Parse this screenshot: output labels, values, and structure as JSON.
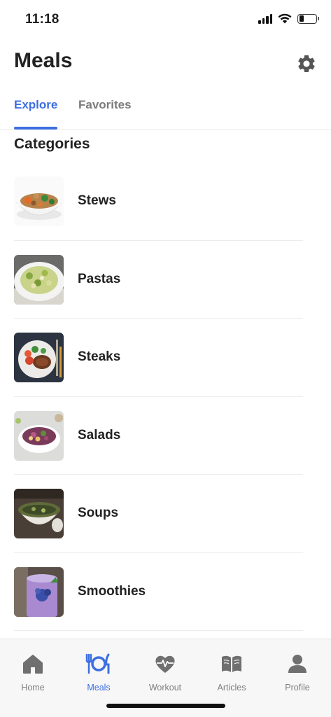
{
  "status_bar": {
    "time": "11:18"
  },
  "header": {
    "title": "Meals",
    "settings_icon": "gear-icon"
  },
  "tabs": [
    {
      "label": "Explore",
      "active": true
    },
    {
      "label": "Favorites",
      "active": false
    }
  ],
  "section": {
    "title": "Categories"
  },
  "categories": [
    {
      "label": "Stews",
      "image": "stew-bowl-image"
    },
    {
      "label": "Pastas",
      "image": "pasta-plate-image"
    },
    {
      "label": "Steaks",
      "image": "steak-plate-image"
    },
    {
      "label": "Salads",
      "image": "salad-bowl-image"
    },
    {
      "label": "Soups",
      "image": "soup-bowl-image"
    },
    {
      "label": "Smoothies",
      "image": "smoothie-glass-image"
    }
  ],
  "tab_bar": {
    "items": [
      {
        "label": "Home",
        "icon": "home-icon",
        "active": false
      },
      {
        "label": "Meals",
        "icon": "meals-icon",
        "active": true
      },
      {
        "label": "Workout",
        "icon": "heart-pulse-icon",
        "active": false
      },
      {
        "label": "Articles",
        "icon": "book-icon",
        "active": false
      },
      {
        "label": "Profile",
        "icon": "person-icon",
        "active": false
      }
    ]
  },
  "colors": {
    "accent": "#3d6fe0",
    "inactive": "#7f7f7f",
    "text": "#222222"
  }
}
